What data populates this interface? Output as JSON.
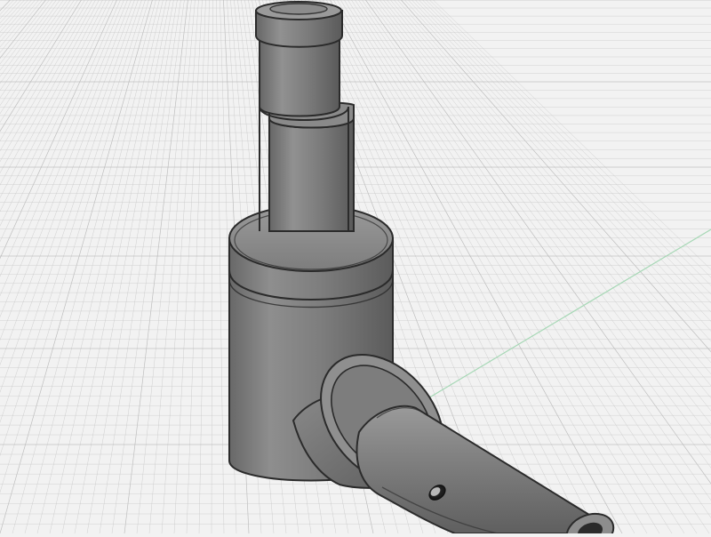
{
  "viewport": {
    "background_color": "#f2f2f2",
    "grid": {
      "visible": true,
      "minor_line_color": "#c6c6c6",
      "major_line_color": "#b9b9b9"
    },
    "axes": {
      "x_axis_color": "#e7a3a3",
      "y_axis_color": "#a7d8b6"
    }
  },
  "model": {
    "name": "",
    "color": "#7f7f7f",
    "edge_color": "#2b2b2b",
    "highlight_color": "#a5a5a5"
  }
}
